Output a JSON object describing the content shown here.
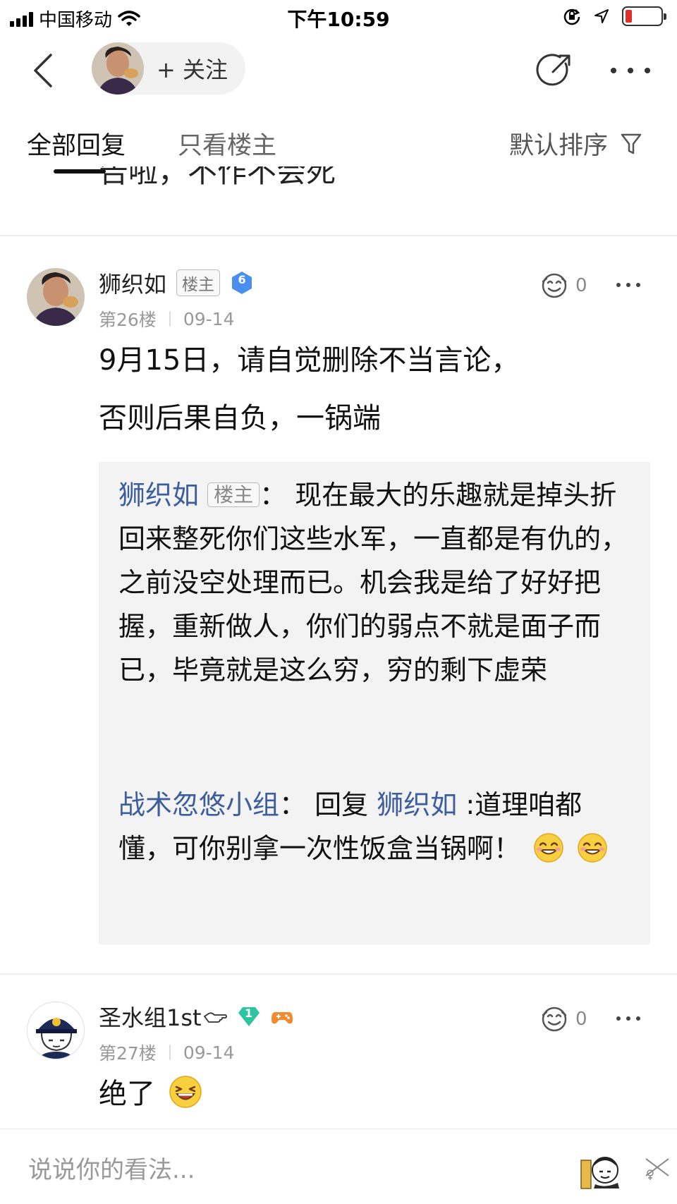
{
  "status_bar": {
    "carrier": "中国移动",
    "time": "下午10:59"
  },
  "nav": {
    "follow_label": "+ 关注"
  },
  "tabs": {
    "all_label": "全部回复",
    "owner_label": "只看楼主",
    "sort_label": "默认排序"
  },
  "previous_post": {
    "cut_text": "告啦，不作不会死"
  },
  "posts": [
    {
      "username": "狮织如",
      "owner_badge": "楼主",
      "level": "6",
      "floor": "第26楼",
      "date": "09-14",
      "likes": "0",
      "content_line1": "9月15日，请自觉删除不当言论，",
      "content_line2": "否则后果自负，一锅端",
      "replies": [
        {
          "username": "狮织如",
          "owner_badge": "楼主",
          "separator": "：",
          "text": "现在最大的乐趣就是掉头折回来整死你们这些水军，一直都是有仇的，之前没空处理而已。机会我是给了好好把握，重新做人，你们的弱点不就是面子而已，毕竟就是这么穷，穷的剩下虚荣"
        },
        {
          "username": "战术忽悠小组",
          "separator": "：",
          "reply_prefix": "回复",
          "reply_target": "狮织如",
          "text": ":道理咱都懂，可你别拿一次性饭盒当锅啊！"
        }
      ]
    },
    {
      "username": "圣水组1st",
      "level": "1",
      "floor": "第27楼",
      "date": "09-14",
      "likes": "0",
      "content": "绝了"
    }
  ],
  "bottom_bar": {
    "placeholder": "说说你的看法..."
  },
  "colors": {
    "link_blue": "#3d5e9c",
    "level6_blue": "#4a8ff0",
    "level1_green": "#2ec4a0",
    "battery_red": "#e0302a"
  }
}
